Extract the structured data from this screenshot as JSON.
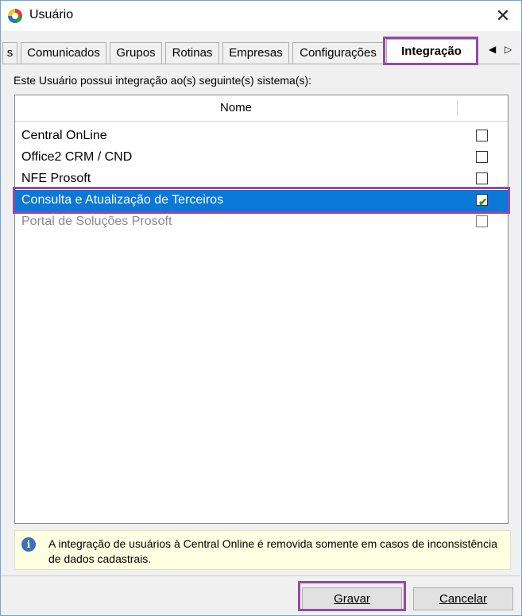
{
  "window": {
    "title": "Usuário"
  },
  "tabs": [
    {
      "label": "s"
    },
    {
      "label": "Comunicados"
    },
    {
      "label": "Grupos"
    },
    {
      "label": "Rotinas"
    },
    {
      "label": "Empresas"
    },
    {
      "label": "Configurações"
    },
    {
      "label": "Integração",
      "active": true
    }
  ],
  "tab_scroll": {
    "left": "◀",
    "right": "▷"
  },
  "panel": {
    "description": "Este Usuário possui integração ao(s) seguinte(s) sistema(s):"
  },
  "grid": {
    "column_name": "Nome",
    "rows": [
      {
        "name": "Central OnLine",
        "checked": false,
        "state": "normal"
      },
      {
        "name": "Office2 CRM / CND",
        "checked": false,
        "state": "normal"
      },
      {
        "name": "NFE Prosoft",
        "checked": false,
        "state": "normal"
      },
      {
        "name": "Consulta e Atualização de Terceiros",
        "checked": true,
        "state": "selected"
      },
      {
        "name": "Portal de Soluções Prosoft",
        "checked": false,
        "state": "disabled"
      }
    ]
  },
  "info": {
    "text": "A integração de usuários à Central Online é removida somente em casos de inconsistência de dados cadastrais."
  },
  "buttons": {
    "save": "Gravar",
    "cancel": "Cancelar"
  },
  "colors": {
    "selection": "#0a78d7",
    "highlight": "#9549a6",
    "info_bg": "#ffffe1"
  }
}
